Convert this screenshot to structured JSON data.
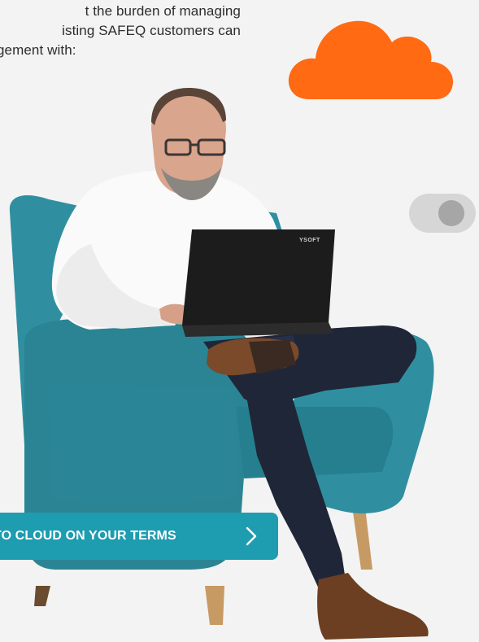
{
  "intro": {
    "lines": [
      "t the burden of managing",
      "isting SAFEQ customers can",
      "gement with:"
    ]
  },
  "laptop": {
    "brand": "YSOFT"
  },
  "cta": {
    "label": "TO CLOUD ON YOUR TERMS",
    "icon": "chevron-right-icon"
  },
  "toggle": {
    "state": "off",
    "icon": "toggle-switch"
  },
  "colors": {
    "cloud": "#ff6a13",
    "cta_background": "#1e9cb0",
    "chair": "#2d8f9e",
    "page_background": "#f3f3f3"
  }
}
